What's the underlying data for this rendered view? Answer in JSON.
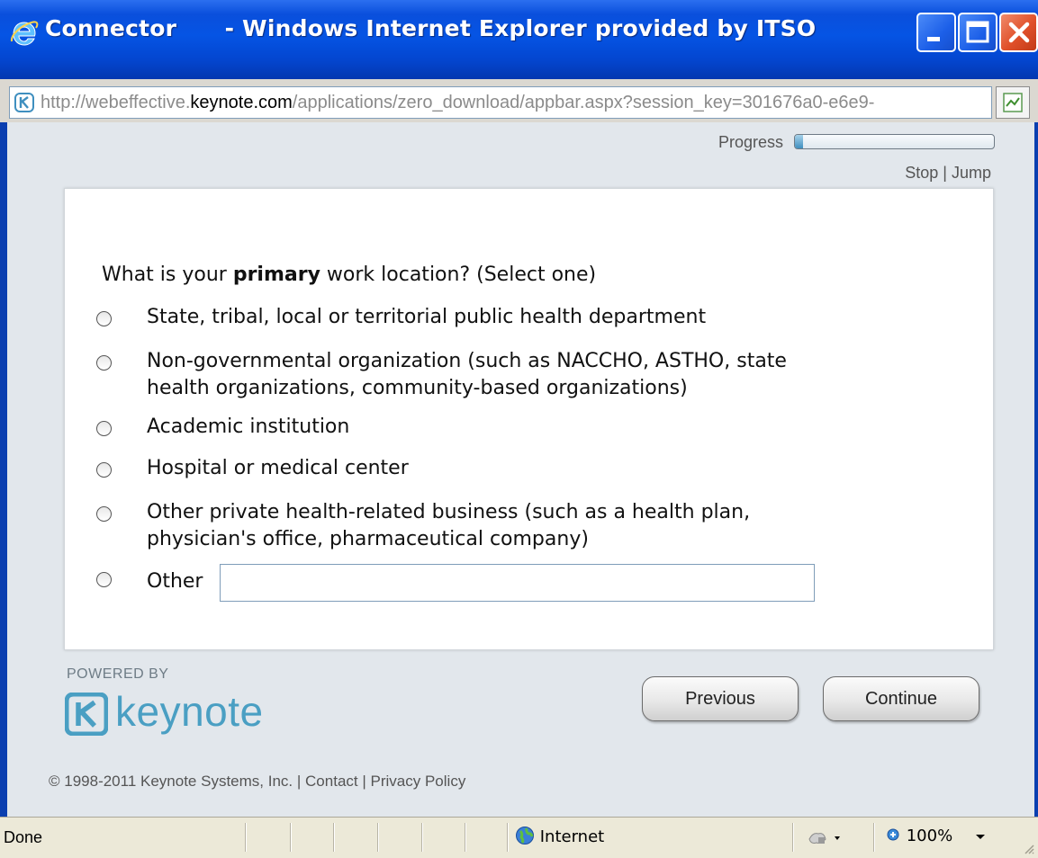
{
  "window": {
    "title": "Connector      - Windows Internet Explorer provided by ITSO"
  },
  "address_bar": {
    "url_prefix": "http://webeffective.",
    "url_domain": "keynote.com",
    "url_suffix": "/applications/zero_download/appbar.aspx?session_key=301676a0-e6e9-"
  },
  "survey": {
    "progress_label": "Progress",
    "progress_fraction": 0.04,
    "stop_label": "Stop",
    "jump_label": "Jump",
    "separator": "|",
    "question_prefix": "What is your ",
    "question_emphasis": "primary",
    "question_suffix": " work location? (Select one)",
    "options": [
      {
        "line1": "State, tribal, local or territorial public health department",
        "line2": ""
      },
      {
        "line1": "Non-governmental organization (such as NACCHO, ASTHO, state",
        "line2": "health organizations, community-based organizations)"
      },
      {
        "line1": "Academic institution",
        "line2": ""
      },
      {
        "line1": "Hospital or medical center",
        "line2": ""
      },
      {
        "line1": "Other private health-related business (such as a health plan,",
        "line2": "physician's office, pharmaceutical company)"
      },
      {
        "line1": "Other",
        "line2": ""
      }
    ],
    "other_value": ""
  },
  "branding": {
    "powered_by": "POWERED BY",
    "logo_text": "keynote"
  },
  "buttons": {
    "previous": "Previous",
    "continue": "Continue"
  },
  "footer": {
    "copyright": "© 1998-2011 Keynote Systems, Inc.",
    "contact": "Contact",
    "privacy": "Privacy Policy",
    "separator": "|"
  },
  "status_bar": {
    "status": "Done",
    "zone": "Internet",
    "zoom": "100%"
  },
  "colors": {
    "titlebar": "#0554e4",
    "close_button": "#e0502a",
    "keynote_brand": "#4a9fc3",
    "content_bg": "#e2e7ec"
  }
}
